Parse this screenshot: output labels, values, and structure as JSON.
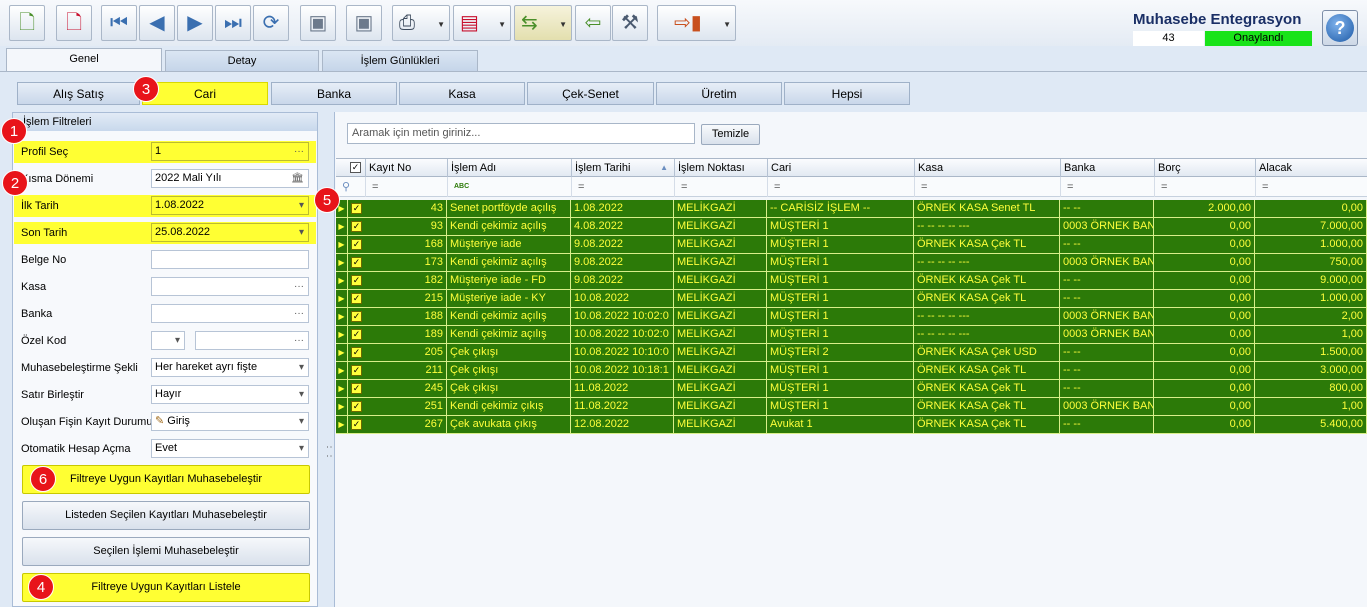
{
  "toolbar": {
    "buttons": [
      {
        "name": "new-doc-button",
        "icon": "new-document-icon",
        "glyph": "📄"
      },
      {
        "name": "delete-doc-button",
        "icon": "delete-document-icon",
        "glyph": "📄"
      },
      {
        "name": "first-record-button",
        "icon": "first-icon",
        "glyph": "⏮"
      },
      {
        "name": "prev-record-button",
        "icon": "prev-icon",
        "glyph": "◀"
      },
      {
        "name": "next-record-button",
        "icon": "next-icon",
        "glyph": "▶"
      },
      {
        "name": "last-record-button",
        "icon": "last-icon",
        "glyph": "⏭"
      },
      {
        "name": "refresh-button",
        "icon": "refresh-icon",
        "glyph": "⟳"
      },
      {
        "name": "save-button",
        "icon": "save-icon",
        "glyph": "💾"
      },
      {
        "name": "save-close-button",
        "icon": "save-close-icon",
        "glyph": "💾"
      },
      {
        "name": "print-button",
        "icon": "printer-icon",
        "glyph": "🖶"
      },
      {
        "name": "pdf-button",
        "icon": "pdf-icon",
        "glyph": "📑"
      },
      {
        "name": "export-button",
        "icon": "export-icon",
        "glyph": "📋"
      },
      {
        "name": "back-button",
        "icon": "back-arrow-icon",
        "glyph": "⇦"
      },
      {
        "name": "tools-button",
        "icon": "wrench-icon",
        "glyph": "🔧"
      },
      {
        "name": "exit-button",
        "icon": "exit-door-icon",
        "glyph": "🚪"
      }
    ]
  },
  "header": {
    "title": "Muhasebe Entegrasyon",
    "count": "43",
    "status": "Onaylandı",
    "status_color": "#19e319"
  },
  "main_tabs": [
    "Genel",
    "Detay",
    "İşlem Günlükleri"
  ],
  "sub_tabs": [
    "Alış Satış",
    "Cari",
    "Banka",
    "Kasa",
    "Çek-Senet",
    "Üretim",
    "Hepsi"
  ],
  "filters": {
    "panel_title": "İşlem Filtreleri",
    "profil_label": "Profil Seç",
    "profil_value": "1",
    "donem_label": "Kısma Dönemi",
    "donem_value": "2022 Mali Yılı",
    "ilk_label": "İlk Tarih",
    "ilk_value": "1.08.2022",
    "son_label": "Son Tarih",
    "son_value": "25.08.2022",
    "belge_label": "Belge No",
    "kasa_label": "Kasa",
    "banka_label": "Banka",
    "ozel_label": "Özel Kod",
    "sekil_label": "Muhasebeleştirme Şekli",
    "sekil_value": "Her hareket ayrı fişte",
    "birlestir_label": "Satır Birleştir",
    "birlestir_value": "Hayır",
    "kayit_label": "Oluşan Fişin Kayıt Durumu",
    "kayit_value": "Giriş",
    "hesap_label": "Otomatik Hesap Açma",
    "hesap_value": "Evet"
  },
  "buttons": {
    "btn1": "Filtreye Uygun Kayıtları Muhasebeleştir",
    "btn2": "Listeden Seçilen Kayıtları Muhasebeleştir",
    "btn3": "Seçilen İşlemi Muhasebeleştir",
    "btn4": "Filtreye Uygun Kayıtları Listele"
  },
  "markers": [
    "1",
    "2",
    "3",
    "4",
    "5",
    "6"
  ],
  "search": {
    "placeholder": "Aramak için metin giriniz...",
    "clear_label": "Temizle"
  },
  "grid": {
    "columns": [
      "Kayıt No",
      "İşlem Adı",
      "İşlem Tarihi",
      "İşlem Noktası",
      "Cari",
      "Kasa",
      "Banka",
      "Borç",
      "Alacak"
    ],
    "filter_symbol": "=",
    "filter_abc": "ABC",
    "rows": [
      [
        "43",
        "Senet portföyde açılış",
        "1.08.2022",
        "MELİKGAZİ",
        "-- CARİSİZ İŞLEM --",
        "ÖRNEK KASA Senet TL",
        "-- --",
        "2.000,00",
        "0,00"
      ],
      [
        "93",
        "Kendi çekimiz açılış",
        "4.08.2022",
        "MELİKGAZİ",
        "MÜŞTERİ 1",
        "-- -- -- -- ---",
        "0003 ÖRNEK BANK",
        "0,00",
        "7.000,00"
      ],
      [
        "168",
        "Müşteriye iade",
        "9.08.2022",
        "MELİKGAZİ",
        "MÜŞTERİ 1",
        "ÖRNEK KASA Çek TL",
        "-- --",
        "0,00",
        "1.000,00"
      ],
      [
        "173",
        "Kendi çekimiz açılış",
        "9.08.2022",
        "MELİKGAZİ",
        "MÜŞTERİ 1",
        "-- -- -- -- ---",
        "0003 ÖRNEK BANK",
        "0,00",
        "750,00"
      ],
      [
        "182",
        "Müşteriye iade - FD",
        "9.08.2022",
        "MELİKGAZİ",
        "MÜŞTERİ 1",
        "ÖRNEK KASA Çek TL",
        "-- --",
        "0,00",
        "9.000,00"
      ],
      [
        "215",
        "Müşteriye iade - KY",
        "10.08.2022",
        "MELİKGAZİ",
        "MÜŞTERİ 1",
        "ÖRNEK KASA Çek TL",
        "-- --",
        "0,00",
        "1.000,00"
      ],
      [
        "188",
        "Kendi çekimiz açılış",
        "10.08.2022 10:02:0",
        "MELİKGAZİ",
        "MÜŞTERİ 1",
        "-- -- -- -- ---",
        "0003 ÖRNEK BANK",
        "0,00",
        "2,00"
      ],
      [
        "189",
        "Kendi çekimiz açılış",
        "10.08.2022 10:02:0",
        "MELİKGAZİ",
        "MÜŞTERİ 1",
        "-- -- -- -- ---",
        "0003 ÖRNEK BANK",
        "0,00",
        "1,00"
      ],
      [
        "205",
        "Çek çıkışı",
        "10.08.2022 10:10:0",
        "MELİKGAZİ",
        "MÜŞTERİ 2",
        "ÖRNEK KASA Çek USD",
        "-- --",
        "0,00",
        "1.500,00"
      ],
      [
        "211",
        "Çek çıkışı",
        "10.08.2022 10:18:1",
        "MELİKGAZİ",
        "MÜŞTERİ 1",
        "ÖRNEK KASA Çek TL",
        "-- --",
        "0,00",
        "3.000,00"
      ],
      [
        "245",
        "Çek çıkışı",
        "11.08.2022",
        "MELİKGAZİ",
        "MÜŞTERİ 1",
        "ÖRNEK KASA Çek TL",
        "-- --",
        "0,00",
        "800,00"
      ],
      [
        "251",
        "Kendi çekimiz çıkış",
        "11.08.2022",
        "MELİKGAZİ",
        "MÜŞTERİ 1",
        "ÖRNEK KASA Çek TL",
        "0003 ÖRNEK BANK",
        "0,00",
        "1,00"
      ],
      [
        "267",
        "Çek avukata çıkış",
        "12.08.2022",
        "MELİKGAZİ",
        "Avukat 1",
        "ÖRNEK KASA Çek TL",
        "-- --",
        "0,00",
        "5.400,00"
      ]
    ]
  },
  "colors": {
    "row_bg": "#2c7a08",
    "row_text": "#ffff3c",
    "highlight": "#ffff33",
    "marker": "#e8141a"
  }
}
